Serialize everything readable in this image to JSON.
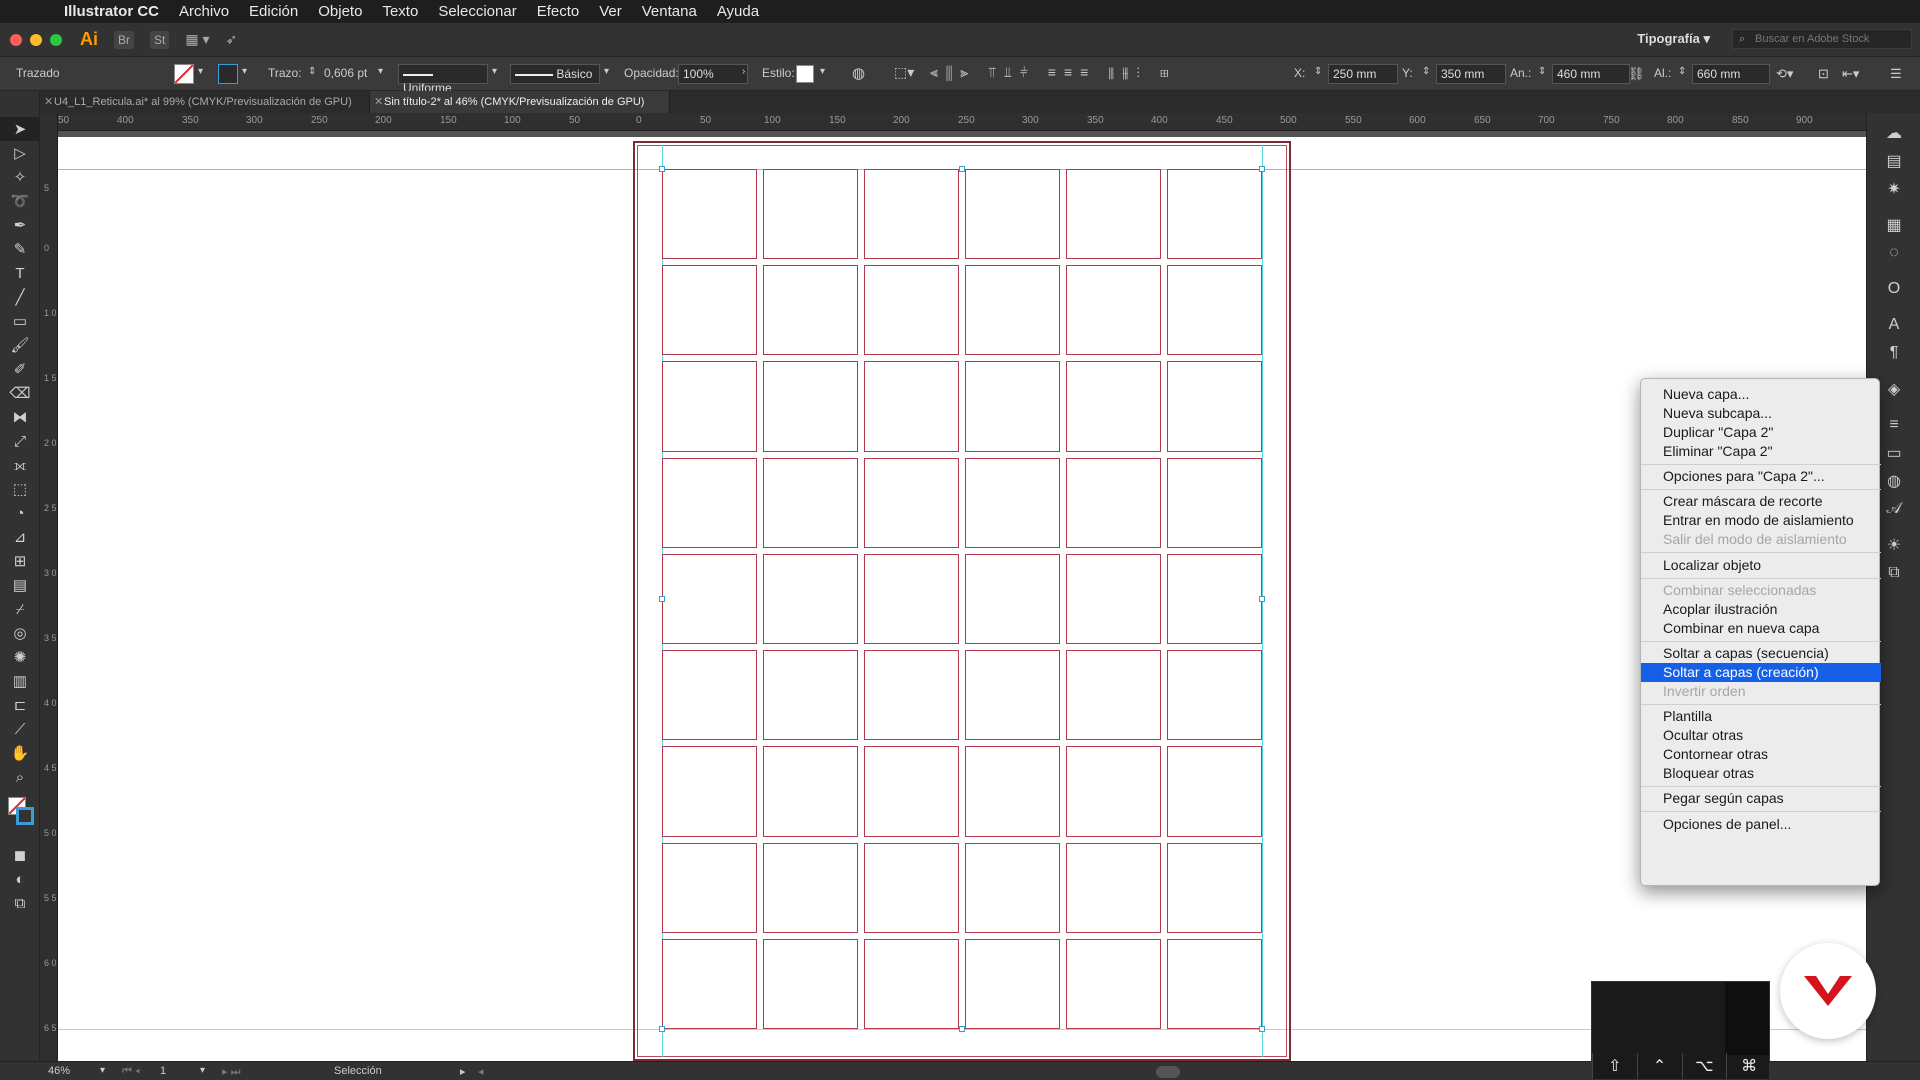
{
  "menubar": {
    "app": "Illustrator CC",
    "items": [
      "Archivo",
      "Edición",
      "Objeto",
      "Texto",
      "Seleccionar",
      "Efecto",
      "Ver",
      "Ventana",
      "Ayuda"
    ]
  },
  "appbar": {
    "logo": "Ai",
    "bridge": "Br",
    "stock": "St",
    "workspace": "Tipografía",
    "search_placeholder": "Buscar en Adobe Stock"
  },
  "control": {
    "object_type": "Trazado",
    "stroke_label": "Trazo:",
    "stroke_value": "0,606 pt",
    "profile_uniform": "Uniforme",
    "brush_basic": "Básico",
    "opacity_label": "Opacidad:",
    "opacity_value": "100%",
    "style_label": "Estilo:",
    "x_label": "X:",
    "x_value": "250 mm",
    "y_label": "Y:",
    "y_value": "350 mm",
    "w_label": "An.:",
    "w_value": "460 mm",
    "h_label": "Al.:",
    "h_value": "660 mm"
  },
  "tabs": [
    {
      "label": "U4_L1_Reticula.ai* al 99% (CMYK/Previsualización de GPU)",
      "active": false
    },
    {
      "label": "Sin título-2* al 46% (CMYK/Previsualización de GPU)",
      "active": true
    }
  ],
  "ruler": {
    "top_labels": [
      "50",
      "400",
      "350",
      "300",
      "250",
      "200",
      "150",
      "100",
      "50",
      "0",
      "50",
      "100",
      "150",
      "200",
      "250",
      "300",
      "350",
      "400",
      "450",
      "500",
      "550",
      "600",
      "650",
      "700",
      "750",
      "800",
      "850",
      "900"
    ],
    "left_labels": [
      "5",
      "0",
      "1 0",
      "1 5",
      "2 0",
      "2 5",
      "3 0",
      "3 5",
      "4 0",
      "4 5",
      "5 0",
      "5 5",
      "6 0",
      "6 5",
      "7 0"
    ]
  },
  "context_menu": {
    "groups": [
      [
        {
          "label": "Nueva capa...",
          "disabled": false
        },
        {
          "label": "Nueva subcapa...",
          "disabled": false
        },
        {
          "label": "Duplicar \"Capa 2\"",
          "disabled": false
        },
        {
          "label": "Eliminar \"Capa 2\"",
          "disabled": false
        }
      ],
      [
        {
          "label": "Opciones para \"Capa 2\"...",
          "disabled": false
        }
      ],
      [
        {
          "label": "Crear máscara de recorte",
          "disabled": false
        },
        {
          "label": "Entrar en modo de aislamiento",
          "disabled": false
        },
        {
          "label": "Salir del modo de aislamiento",
          "disabled": true
        }
      ],
      [
        {
          "label": "Localizar objeto",
          "disabled": false
        }
      ],
      [
        {
          "label": "Combinar seleccionadas",
          "disabled": true
        },
        {
          "label": "Acoplar ilustración",
          "disabled": false
        },
        {
          "label": "Combinar en nueva capa",
          "disabled": false
        }
      ],
      [
        {
          "label": "Soltar a capas (secuencia)",
          "disabled": false
        },
        {
          "label": "Soltar a capas (creación)",
          "disabled": false,
          "highlighted": true
        },
        {
          "label": "Invertir orden",
          "disabled": true
        }
      ],
      [
        {
          "label": "Plantilla",
          "disabled": false
        },
        {
          "label": "Ocultar otras",
          "disabled": false
        },
        {
          "label": "Contornear otras",
          "disabled": false
        },
        {
          "label": "Bloquear otras",
          "disabled": false
        }
      ],
      [
        {
          "label": "Pegar según capas",
          "disabled": false
        }
      ],
      [
        {
          "label": "Opciones de panel...",
          "disabled": false
        }
      ]
    ]
  },
  "status": {
    "zoom": "46%",
    "artboard": "1",
    "tool": "Selección"
  },
  "grid": {
    "columns": 6,
    "rows": 9
  },
  "colors": {
    "accent_orange": "#ff9a00",
    "guide_cyan": "#5ad6de",
    "grid_red": "#b03a4a",
    "menu_highlight": "#1660e8",
    "logo_red": "#d4141c"
  },
  "keyboard_overlay": {
    "keys": [
      "⇧",
      "⌃",
      "⌥",
      "⌘"
    ]
  }
}
